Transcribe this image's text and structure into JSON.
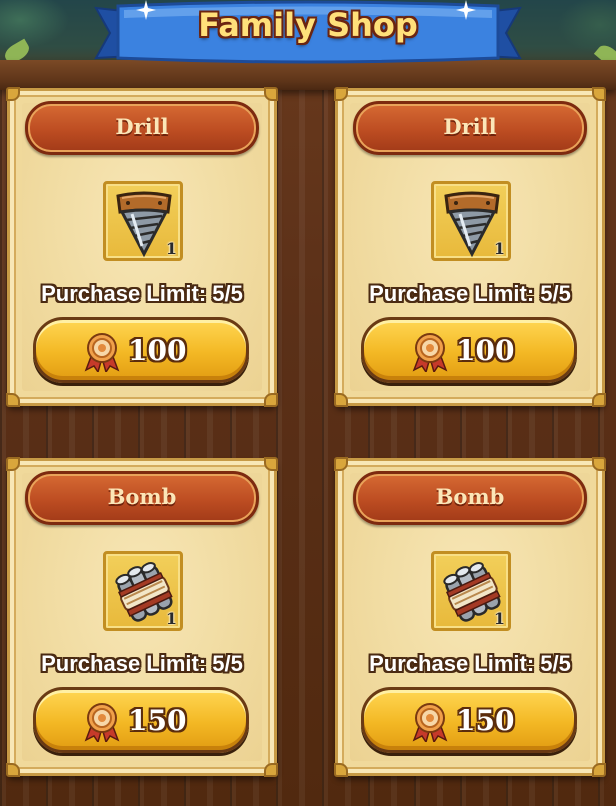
{
  "header": {
    "title": "Family Shop",
    "left_icon": "sparkle-icon",
    "right_icon": "sparkle-icon"
  },
  "shop": {
    "currency_icon": "medal-icon",
    "items": [
      {
        "name": "Drill",
        "icon": "drill-icon",
        "quantity": "1",
        "limit_text": "Purchase Limit: 5/5",
        "price": "100"
      },
      {
        "name": "Drill",
        "icon": "drill-icon",
        "quantity": "1",
        "limit_text": "Purchase Limit: 5/5",
        "price": "100"
      },
      {
        "name": "Bomb",
        "icon": "bomb-icon",
        "quantity": "1",
        "limit_text": "Purchase Limit: 5/5",
        "price": "150"
      },
      {
        "name": "Bomb",
        "icon": "bomb-icon",
        "quantity": "1",
        "limit_text": "Purchase Limit: 5/5",
        "price": "150"
      }
    ]
  },
  "colors": {
    "banner_blue": "#2f6fd0",
    "title_gold": "#ffe07a",
    "card_bg": "#f0d99b",
    "name_plate": "#c4532a",
    "button_gold": "#f3b824",
    "wood": "#5b3018"
  }
}
